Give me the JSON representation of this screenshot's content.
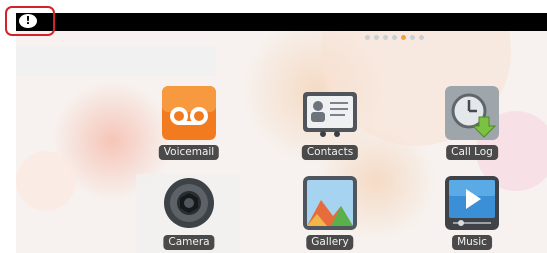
{
  "status_bar": {
    "notification_icon": "warning-exclamation-icon",
    "notification_glyph": "!"
  },
  "home_screen": {
    "page_indicator": {
      "pages": 7,
      "active_index": 4
    },
    "apps": [
      {
        "id": "voicemail",
        "label": "Voicemail",
        "icon": "voicemail-icon"
      },
      {
        "id": "contacts",
        "label": "Contacts",
        "icon": "contacts-icon"
      },
      {
        "id": "call_log",
        "label": "Call Log",
        "icon": "call-log-icon"
      },
      {
        "id": "camera",
        "label": "Camera",
        "icon": "camera-icon"
      },
      {
        "id": "gallery",
        "label": "Gallery",
        "icon": "gallery-icon"
      },
      {
        "id": "music",
        "label": "Music",
        "icon": "music-icon"
      }
    ]
  },
  "colors": {
    "status_bar": "#000000",
    "highlight": "#d3232a",
    "voicemail_tile": "#f27b1f",
    "label_background": "#4a4a4a",
    "page_dot_active": "#f2a23a"
  }
}
